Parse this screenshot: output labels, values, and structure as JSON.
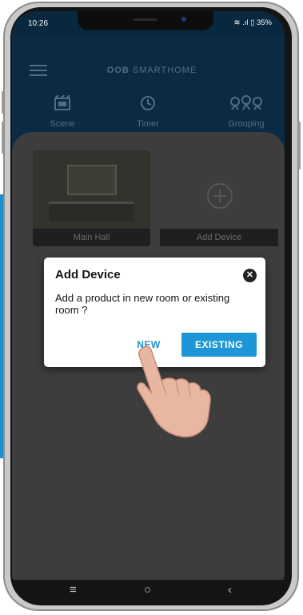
{
  "status_bar": {
    "time": "10:26",
    "indicators": "≋ .ıl ▯ 35%"
  },
  "header": {
    "menu_icon": "hamburger-icon",
    "logo_bold": "OOB",
    "logo_rest": "SMARTHOME"
  },
  "nav_tabs": [
    {
      "label": "Scene",
      "icon": "scene-icon"
    },
    {
      "label": "Timer",
      "icon": "clock-icon"
    },
    {
      "label": "Grouping",
      "icon": "grouping-icon"
    }
  ],
  "rooms": [
    {
      "label": "Main Hall"
    },
    {
      "label": "Add Device",
      "icon": "plus-circle-icon"
    }
  ],
  "dialog": {
    "title": "Add Device",
    "close_icon": "close-icon",
    "message": "Add a product in new room or existing room ?",
    "new_button": "NEW",
    "existing_button": "EXISTING"
  },
  "system_nav": {
    "menu": "≡",
    "home": "○",
    "back": "‹"
  },
  "colors": {
    "accent": "#1c96d6",
    "header": "#0b2b45",
    "overlay": "#3d3d3d"
  }
}
